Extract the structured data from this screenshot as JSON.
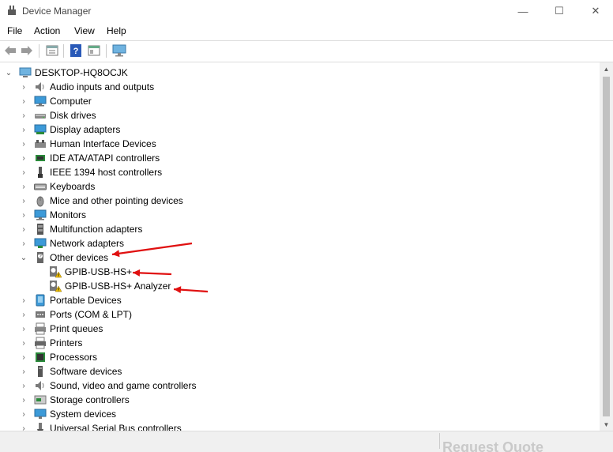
{
  "window": {
    "title": "Device Manager",
    "minimize_glyph": "—",
    "maximize_glyph": "☐",
    "close_glyph": "✕"
  },
  "menu": {
    "items": [
      "File",
      "Action",
      "View",
      "Help"
    ]
  },
  "toolbar": {
    "buttons": [
      "back-icon",
      "forward-icon",
      "properties-icon",
      "help-icon",
      "details-icon",
      "monitor-icon"
    ]
  },
  "tree": {
    "root": "DESKTOP-HQ8OCJK",
    "categories": [
      {
        "label": "Audio inputs and outputs",
        "icon": "speaker-icon",
        "expanded": false
      },
      {
        "label": "Computer",
        "icon": "computer-icon",
        "expanded": false
      },
      {
        "label": "Disk drives",
        "icon": "disk-icon",
        "expanded": false
      },
      {
        "label": "Display adapters",
        "icon": "display-adapter-icon",
        "expanded": false
      },
      {
        "label": "Human Interface Devices",
        "icon": "hid-icon",
        "expanded": false
      },
      {
        "label": "IDE ATA/ATAPI controllers",
        "icon": "ide-icon",
        "expanded": false
      },
      {
        "label": "IEEE 1394 host controllers",
        "icon": "firewire-icon",
        "expanded": false
      },
      {
        "label": "Keyboards",
        "icon": "keyboard-icon",
        "expanded": false
      },
      {
        "label": "Mice and other pointing devices",
        "icon": "mouse-icon",
        "expanded": false
      },
      {
        "label": "Monitors",
        "icon": "monitor-icon",
        "expanded": false
      },
      {
        "label": "Multifunction adapters",
        "icon": "multifunction-icon",
        "expanded": false
      },
      {
        "label": "Network adapters",
        "icon": "network-icon",
        "expanded": false
      },
      {
        "label": "Other devices",
        "icon": "unknown-device-icon",
        "expanded": true,
        "children": [
          {
            "label": "GPIB-USB-HS+",
            "icon": "warning-device-icon"
          },
          {
            "label": "GPIB-USB-HS+ Analyzer",
            "icon": "warning-device-icon"
          }
        ]
      },
      {
        "label": "Portable Devices",
        "icon": "portable-device-icon",
        "expanded": false
      },
      {
        "label": "Ports (COM & LPT)",
        "icon": "port-icon",
        "expanded": false
      },
      {
        "label": "Print queues",
        "icon": "print-queue-icon",
        "expanded": false
      },
      {
        "label": "Printers",
        "icon": "printer-icon",
        "expanded": false
      },
      {
        "label": "Processors",
        "icon": "processor-icon",
        "expanded": false
      },
      {
        "label": "Software devices",
        "icon": "software-device-icon",
        "expanded": false
      },
      {
        "label": "Sound, video and game controllers",
        "icon": "speaker-icon",
        "expanded": false
      },
      {
        "label": "Storage controllers",
        "icon": "storage-icon",
        "expanded": false
      },
      {
        "label": "System devices",
        "icon": "system-icon",
        "expanded": false
      },
      {
        "label": "Universal Serial Bus controllers",
        "icon": "usb-icon",
        "expanded": false
      }
    ]
  },
  "status": {
    "overlay_text": "Request Quote"
  },
  "colors": {
    "annotation_arrow": "#e01010",
    "warning": "#f2c200"
  }
}
